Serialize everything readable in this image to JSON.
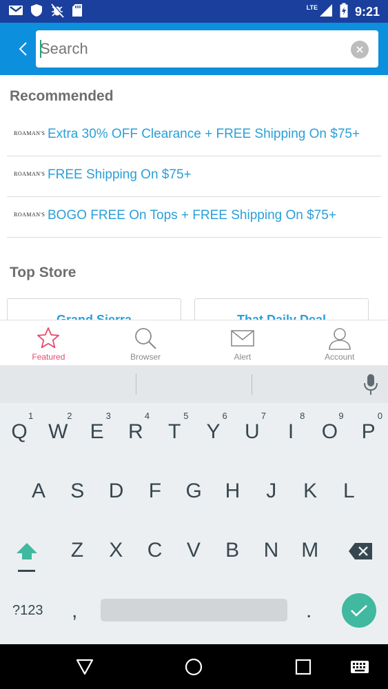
{
  "status_bar": {
    "time": "9:21",
    "network": "LTE",
    "left_icons": [
      "gmail-icon",
      "shield-icon",
      "bug-off-icon",
      "sd-card-icon"
    ],
    "right_icons": [
      "signal-icon",
      "battery-charging-icon"
    ]
  },
  "search": {
    "placeholder": "Search",
    "value": ""
  },
  "recommended": {
    "title": "Recommended",
    "items": [
      {
        "logo": "ROAMAN'S",
        "text": "Extra 30% OFF Clearance + FREE Shipping On $75+"
      },
      {
        "logo": "ROAMAN'S",
        "text": "FREE Shipping On $75+"
      },
      {
        "logo": "ROAMAN'S",
        "text": "BOGO FREE On Tops + FREE Shipping On $75+"
      }
    ]
  },
  "top_store": {
    "title": "Top Store",
    "stores": [
      {
        "name": "Grand Sierra"
      },
      {
        "name": "That Daily Deal"
      }
    ]
  },
  "bottom_nav": {
    "items": [
      {
        "label": "Featured",
        "icon": "star-icon",
        "active": true
      },
      {
        "label": "Browser",
        "icon": "search-icon",
        "active": false
      },
      {
        "label": "Alert",
        "icon": "envelope-icon",
        "active": false
      },
      {
        "label": "Account",
        "icon": "person-icon",
        "active": false
      }
    ]
  },
  "keyboard": {
    "row1": [
      "Q",
      "W",
      "E",
      "R",
      "T",
      "Y",
      "U",
      "I",
      "O",
      "P"
    ],
    "row1_hints": [
      "1",
      "2",
      "3",
      "4",
      "5",
      "6",
      "7",
      "8",
      "9",
      "0"
    ],
    "row2": [
      "A",
      "S",
      "D",
      "F",
      "G",
      "H",
      "J",
      "K",
      "L"
    ],
    "row3": [
      "Z",
      "X",
      "C",
      "V",
      "B",
      "N",
      "M"
    ],
    "symbols_label": "?123",
    "comma": ",",
    "period": "."
  },
  "colors": {
    "status_bar": "#1a3f9c",
    "app_bar": "#0c8fdd",
    "link": "#2a9fd8",
    "active_nav": "#e8476e",
    "enter_key": "#40b9a0",
    "shift_key": "#40b9a0"
  }
}
